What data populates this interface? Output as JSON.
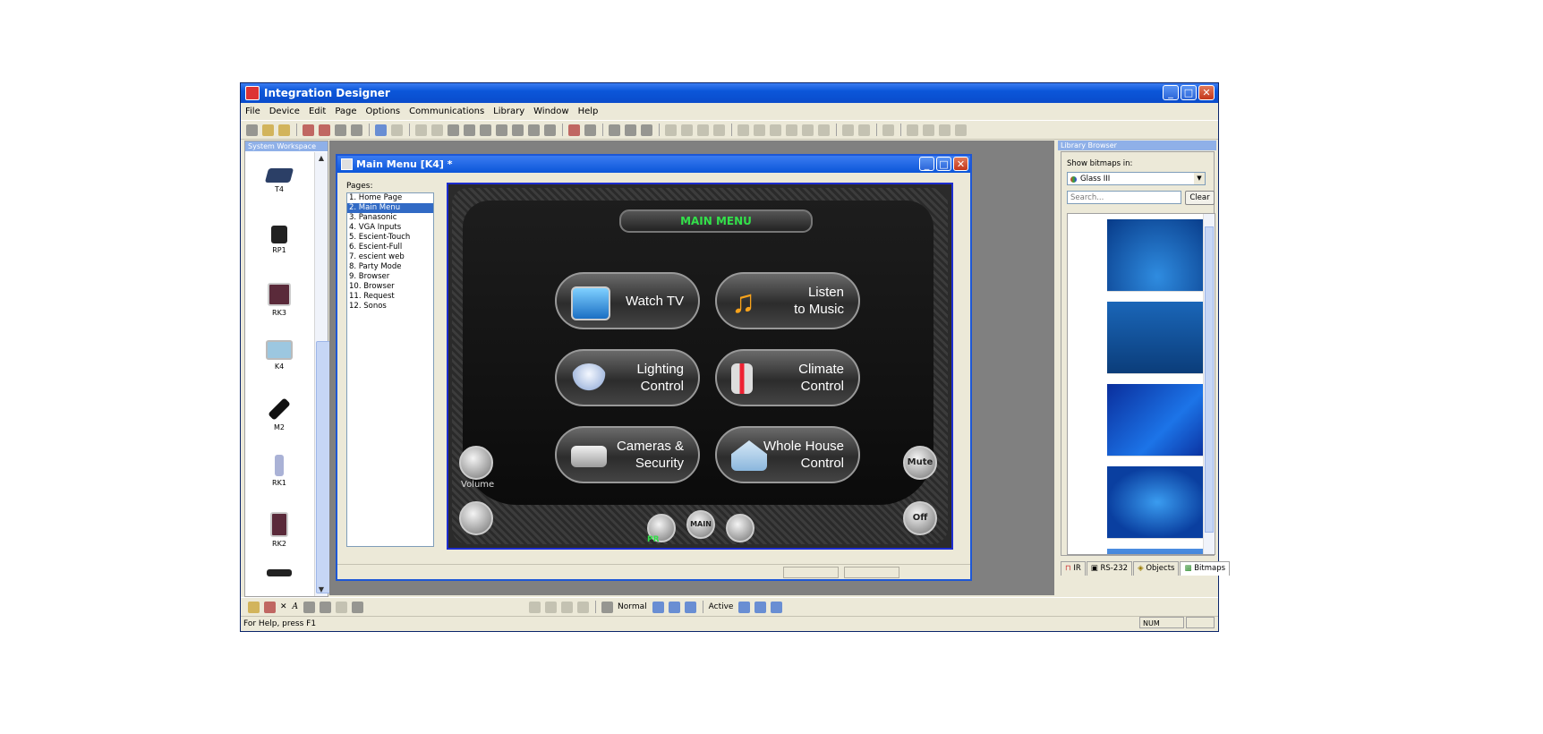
{
  "window": {
    "title": "Integration Designer"
  },
  "menu": [
    "File",
    "Device",
    "Edit",
    "Page",
    "Options",
    "Communications",
    "Library",
    "Window",
    "Help"
  ],
  "workspace": {
    "header": "System Workspace",
    "devices": [
      {
        "label": "T4"
      },
      {
        "label": "RP1"
      },
      {
        "label": "RK3"
      },
      {
        "label": "K4"
      },
      {
        "label": "M2"
      },
      {
        "label": "RK1"
      },
      {
        "label": "RK2"
      },
      {
        "label": ""
      }
    ]
  },
  "child": {
    "title": "Main Menu [K4] *",
    "pages_label": "Pages:",
    "pages": [
      {
        "label": "1. Home Page",
        "selected": false
      },
      {
        "label": "2. Main Menu",
        "selected": true
      },
      {
        "label": "3. Panasonic",
        "selected": false
      },
      {
        "label": "4. VGA Inputs",
        "selected": false
      },
      {
        "label": "5. Escient-Touch",
        "selected": false
      },
      {
        "label": "6. Escient-Full",
        "selected": false
      },
      {
        "label": "7. escient web",
        "selected": false
      },
      {
        "label": "8. Party Mode",
        "selected": false
      },
      {
        "label": "9. Browser",
        "selected": false
      },
      {
        "label": "10. Browser",
        "selected": false
      },
      {
        "label": "11. Request",
        "selected": false
      },
      {
        "label": "12. Sonos",
        "selected": false
      }
    ]
  },
  "panel": {
    "title": "MAIN MENU",
    "buttons": [
      {
        "label": "Watch TV",
        "icon": "tv-icon"
      },
      {
        "label": "Listen\nto Music",
        "icon": "music-note-icon"
      },
      {
        "label": "Lighting\nControl",
        "icon": "light-bulb-icon"
      },
      {
        "label": "Climate\nControl",
        "icon": "thermometer-icon"
      },
      {
        "label": "Cameras &\nSecurity",
        "icon": "camera-icon"
      },
      {
        "label": "Whole House\nControl",
        "icon": "house-icon"
      }
    ],
    "volume_label": "Volume",
    "mute_label": "Mute",
    "off_label": "Off",
    "main_label": "MAIN",
    "pr_label": "PR"
  },
  "library": {
    "header": "Library Browser",
    "show_label": "Show bitmaps in:",
    "selected": "Glass III",
    "search_placeholder": "Search...",
    "clear_label": "Clear",
    "tabs": [
      "IR",
      "RS-232",
      "Objects",
      "Bitmaps"
    ],
    "active_tab": "Bitmaps"
  },
  "drawbar": {
    "normal_label": "Normal",
    "active_label": "Active"
  },
  "status": {
    "text": "For Help, press F1",
    "num": "NUM"
  },
  "colors": {
    "title_blue": "#0b56d9",
    "accent_green": "#33e04a",
    "selection": "#316ac5"
  }
}
